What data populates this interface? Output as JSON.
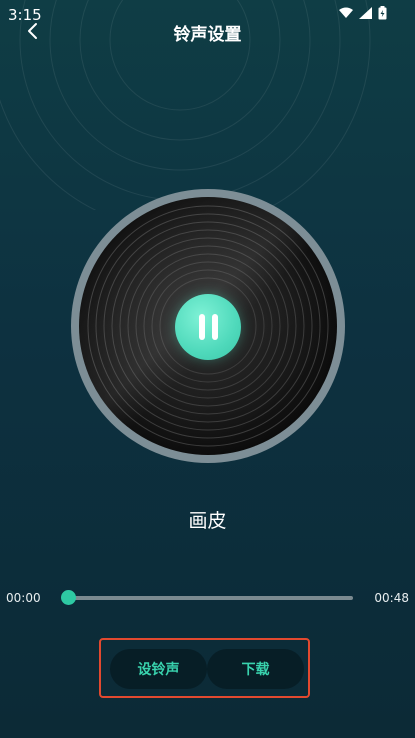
{
  "status_bar": {
    "time": "3:15",
    "icons": [
      "wifi-icon",
      "signal-icon",
      "battery-icon"
    ]
  },
  "header": {
    "back_icon": "chevron-left-icon",
    "title": "铃声设置"
  },
  "player": {
    "song_title": "画皮",
    "state_icon": "pause-icon",
    "current_time": "00:00",
    "total_time": "00:48",
    "progress_fraction": 0
  },
  "actions": {
    "set_ringtone_label": "设铃声",
    "download_label": "下载"
  },
  "colors": {
    "accent": "#2ec9a3",
    "button_text": "#39d3ae",
    "highlight_border": "#e2492f",
    "background_top": "#0f3d45",
    "background_bottom": "#0c2a36"
  }
}
